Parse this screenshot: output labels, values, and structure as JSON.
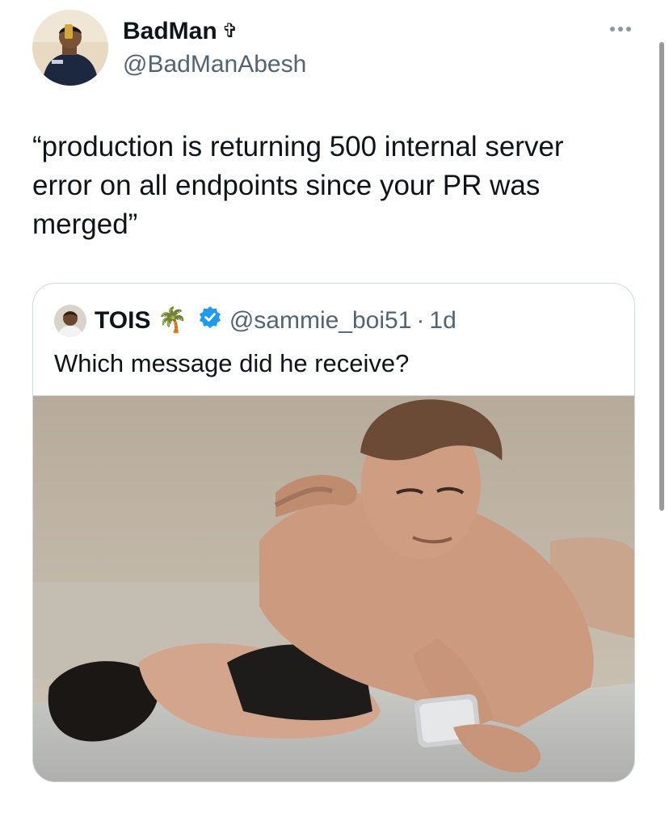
{
  "tweet": {
    "author_name": "BadMan",
    "author_emoji": "✞",
    "author_handle": "@BadManAbesh",
    "text": "“production is returning 500 internal server error on all endpoints since your PR was merged”",
    "more_icon": "more-horizontal-icon"
  },
  "quote": {
    "author_name": "TOIS",
    "author_emoji": "🌴",
    "verified_icon": "verified-badge-icon",
    "author_handle": "@sammie_boi51",
    "separator": "·",
    "time": "1d",
    "text": "Which message did he receive?",
    "image": "photo"
  },
  "colors": {
    "text": "#0f1419",
    "secondary": "#536471",
    "border": "#cfd9de",
    "verified": "#1d9bf0"
  }
}
